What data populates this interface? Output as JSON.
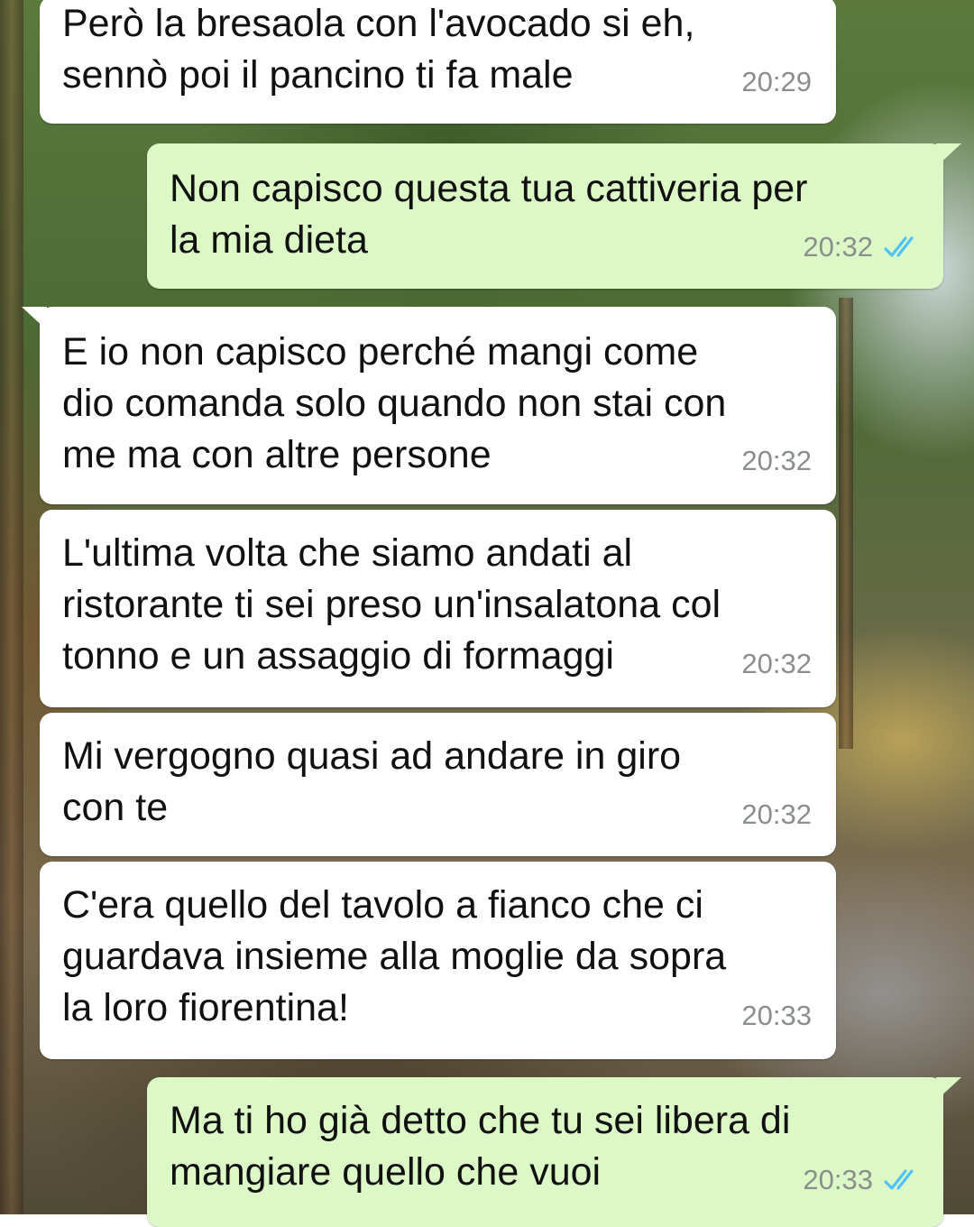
{
  "messages": [
    {
      "direction": "in",
      "text": "Però la bresaola con l'avocado si eh,\nsennò poi il pancino ti fa male",
      "time": "20:29"
    },
    {
      "direction": "out",
      "text": "Non capisco questa tua cattiveria per\nla mia dieta",
      "time": "20:32",
      "status": "read"
    },
    {
      "direction": "in",
      "text": "E io non capisco perché mangi come\ndio comanda solo quando non stai con\nme ma con altre persone",
      "time": "20:32"
    },
    {
      "direction": "in",
      "text": "L'ultima volta che siamo andati al\nristorante ti sei preso un'insalatona col\ntonno e un assaggio di formaggi",
      "time": "20:32"
    },
    {
      "direction": "in",
      "text": "Mi vergogno quasi ad andare in giro\ncon te",
      "time": "20:32"
    },
    {
      "direction": "in",
      "text": "C'era quello del tavolo a fianco che ci\nguardava insieme alla moglie da sopra\nla loro fiorentina!",
      "time": "20:33"
    },
    {
      "direction": "out",
      "text": "Ma ti ho già detto che tu sei libera di\nmangiare quello che vuoi",
      "time": "20:33",
      "status": "read"
    }
  ],
  "colors": {
    "incoming_bubble": "#ffffff",
    "outgoing_bubble": "#dcf8c6",
    "read_tick": "#4fc3f7",
    "timestamp": "#8a8f8c"
  },
  "icons": {
    "read_receipt": "double-check-icon"
  }
}
